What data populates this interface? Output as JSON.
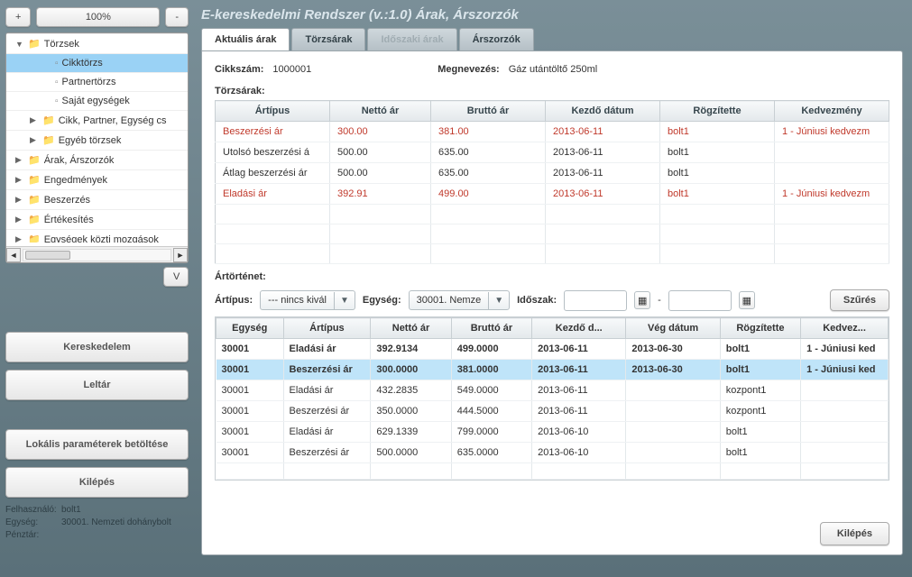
{
  "zoom": {
    "plus": "+",
    "val": "100%",
    "minus": "-"
  },
  "tree": {
    "items": [
      {
        "label": "Törzsek",
        "type": "folder",
        "arrow": "▼",
        "indent": 0
      },
      {
        "label": "Cikktörzs",
        "type": "file",
        "indent": 2,
        "selected": true
      },
      {
        "label": "Partnertörzs",
        "type": "file",
        "indent": 2
      },
      {
        "label": "Saját egységek",
        "type": "file",
        "indent": 2
      },
      {
        "label": "Cikk, Partner, Egység cs",
        "type": "folder",
        "arrow": "▶",
        "indent": 1
      },
      {
        "label": "Egyéb törzsek",
        "type": "folder",
        "arrow": "▶",
        "indent": 1
      },
      {
        "label": "Árak, Árszorzók",
        "type": "folder",
        "arrow": "▶",
        "indent": 0
      },
      {
        "label": "Engedmények",
        "type": "folder",
        "arrow": "▶",
        "indent": 0
      },
      {
        "label": "Beszerzés",
        "type": "folder",
        "arrow": "▶",
        "indent": 0
      },
      {
        "label": "Értékesítés",
        "type": "folder",
        "arrow": "▶",
        "indent": 0
      },
      {
        "label": "Egységek közti mozgások",
        "type": "folder",
        "arrow": "▶",
        "indent": 0
      }
    ],
    "vbtn": "V"
  },
  "left_buttons": {
    "trade": "Kereskedelem",
    "inventory": "Leltár",
    "load_params": "Lokális paraméterek betöltése",
    "exit": "Kilépés"
  },
  "status": {
    "user_lbl": "Felhasználó:",
    "user": "bolt1",
    "unit_lbl": "Egység:",
    "unit": "30001. Nemzeti dohánybolt",
    "till_lbl": "Pénztár:",
    "till": ""
  },
  "title": "E-kereskedelmi Rendszer (v.:1.0)   Árak, Árszorzók",
  "tabs": {
    "t1": "Aktuális árak",
    "t2": "Törzsárak",
    "t3": "Időszaki árak",
    "t4": "Árszorzók"
  },
  "head": {
    "code_lbl": "Cikkszám:",
    "code": "1000001",
    "name_lbl": "Megnevezés:",
    "name": "Gáz utántöltő 250ml"
  },
  "section1": "Törzsárak:",
  "cols1": {
    "c1": "Ártípus",
    "c2": "Nettó ár",
    "c3": "Bruttó ár",
    "c4": "Kezdő dátum",
    "c5": "Rögzítette",
    "c6": "Kedvezmény"
  },
  "rows1": [
    {
      "red": true,
      "c1": "Beszerzési ár",
      "c2": "300.00",
      "c3": "381.00",
      "c4": "2013-06-11",
      "c5": "bolt1",
      "c6": "1 - Júniusi kedvezm"
    },
    {
      "red": false,
      "c1": "Utolsó beszerzési á",
      "c2": "500.00",
      "c3": "635.00",
      "c4": "2013-06-11",
      "c5": "bolt1",
      "c6": ""
    },
    {
      "red": false,
      "c1": "Átlag beszerzési ár",
      "c2": "500.00",
      "c3": "635.00",
      "c4": "2013-06-11",
      "c5": "bolt1",
      "c6": ""
    },
    {
      "red": true,
      "c1": "Eladási ár",
      "c2": "392.91",
      "c3": "499.00",
      "c4": "2013-06-11",
      "c5": "bolt1",
      "c6": "1 - Júniusi kedvezm"
    }
  ],
  "section2": "Ártörténet:",
  "filter": {
    "type_lbl": "Ártípus:",
    "type_val": "--- nincs kivál",
    "unit_lbl": "Egység:",
    "unit_val": "30001. Nemze",
    "period_lbl": "Időszak:",
    "dash": "-",
    "btn": "Szűrés"
  },
  "cols2": {
    "c1": "Egység",
    "c2": "Ártípus",
    "c3": "Nettó ár",
    "c4": "Bruttó ár",
    "c5": "Kezdő d...",
    "c6": "Vég dátum",
    "c7": "Rögzítette",
    "c8": "Kedvez..."
  },
  "rows2": [
    {
      "bold": true,
      "hl": false,
      "c1": "30001",
      "c2": "Eladási ár",
      "c3": "392.9134",
      "c4": "499.0000",
      "c5": "2013-06-11",
      "c6": "2013-06-30",
      "c7": "bolt1",
      "c8": "1 - Júniusi ked"
    },
    {
      "bold": true,
      "hl": true,
      "c1": "30001",
      "c2": "Beszerzési ár",
      "c3": "300.0000",
      "c4": "381.0000",
      "c5": "2013-06-11",
      "c6": "2013-06-30",
      "c7": "bolt1",
      "c8": "1 - Júniusi ked"
    },
    {
      "bold": false,
      "hl": false,
      "c1": "30001",
      "c2": "Eladási ár",
      "c3": "432.2835",
      "c4": "549.0000",
      "c5": "2013-06-11",
      "c6": "",
      "c7": "kozpont1",
      "c8": ""
    },
    {
      "bold": false,
      "hl": false,
      "c1": "30001",
      "c2": "Beszerzési ár",
      "c3": "350.0000",
      "c4": "444.5000",
      "c5": "2013-06-11",
      "c6": "",
      "c7": "kozpont1",
      "c8": ""
    },
    {
      "bold": false,
      "hl": false,
      "c1": "30001",
      "c2": "Eladási ár",
      "c3": "629.1339",
      "c4": "799.0000",
      "c5": "2013-06-10",
      "c6": "",
      "c7": "bolt1",
      "c8": ""
    },
    {
      "bold": false,
      "hl": false,
      "c1": "30001",
      "c2": "Beszerzési ár",
      "c3": "500.0000",
      "c4": "635.0000",
      "c5": "2013-06-10",
      "c6": "",
      "c7": "bolt1",
      "c8": ""
    }
  ],
  "close_btn": "Kilépés"
}
